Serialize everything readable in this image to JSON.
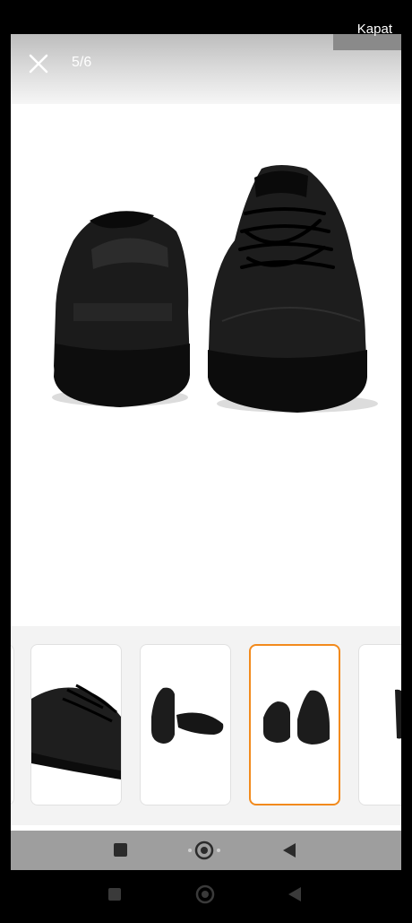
{
  "gallery": {
    "counter": "5/6",
    "close_label": "Kapat"
  },
  "colors": {
    "selected_border": "#f28a1c",
    "header_gradient_top": "#bdbdbd",
    "bottom_bar": "#9e9e9e"
  },
  "icons": {
    "close": "close-icon",
    "bar_square": "square-icon",
    "bar_center": "target-icon",
    "bar_back": "back-triangle-icon"
  }
}
